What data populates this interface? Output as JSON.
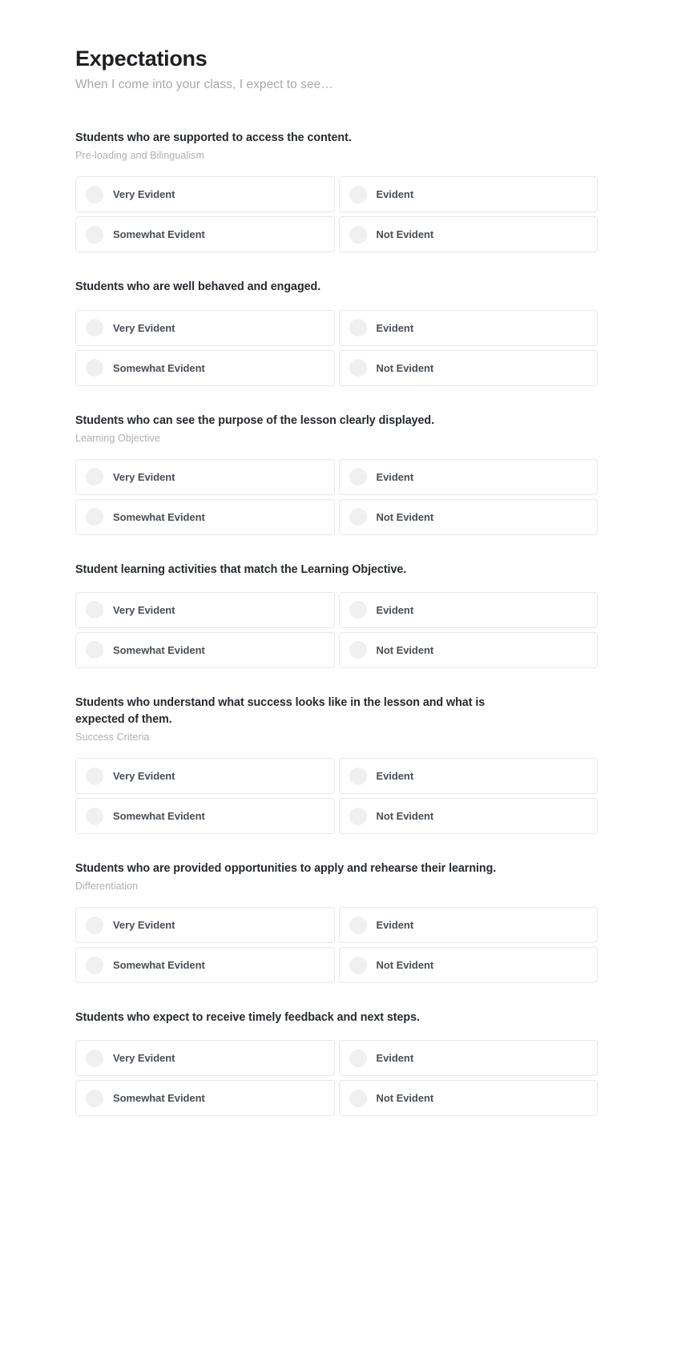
{
  "header": {
    "title": "Expectations",
    "subtitle": "When I come into your class, I expect to see…"
  },
  "options_template": [
    "Very Evident",
    "Evident",
    "Somewhat Evident",
    "Not Evident"
  ],
  "colors": {
    "title_text": "#1d1f22",
    "subtitle_text": "#a6a9ad",
    "question_text": "#262a2e",
    "question_subtitle_text": "#acafb3",
    "option_label_text": "#4a4f55",
    "card_border": "#e6e7e8",
    "radio_fill": "#f0f0f1",
    "background": "#ffffff"
  },
  "questions": [
    {
      "title": "Students who are supported to access the content.",
      "subtitle": "Pre-loading and Bilingualism",
      "options": [
        "Very Evident",
        "Evident",
        "Somewhat Evident",
        "Not Evident"
      ]
    },
    {
      "title": "Students who are well behaved and engaged.",
      "subtitle": "",
      "options": [
        "Very Evident",
        "Evident",
        "Somewhat Evident",
        "Not Evident"
      ]
    },
    {
      "title": "Students who can see the purpose of the lesson clearly displayed.",
      "subtitle": "Learning Objective",
      "options": [
        "Very Evident",
        "Evident",
        "Somewhat Evident",
        "Not Evident"
      ]
    },
    {
      "title": "Student learning activities that match the Learning Objective.",
      "subtitle": "",
      "options": [
        "Very Evident",
        "Evident",
        "Somewhat Evident",
        "Not Evident"
      ]
    },
    {
      "title": "Students who understand what success looks like in the lesson and what is expected of them.",
      "subtitle": "Success Criteria",
      "options": [
        "Very Evident",
        "Evident",
        "Somewhat Evident",
        "Not Evident"
      ]
    },
    {
      "title": "Students who are provided opportunities to apply and rehearse their learning.",
      "subtitle": "Differentiation",
      "options": [
        "Very Evident",
        "Evident",
        "Somewhat Evident",
        "Not Evident"
      ]
    },
    {
      "title": "Students who expect to receive timely feedback and next steps.",
      "subtitle": "",
      "options": [
        "Very Evident",
        "Evident",
        "Somewhat Evident",
        "Not Evident"
      ]
    }
  ]
}
